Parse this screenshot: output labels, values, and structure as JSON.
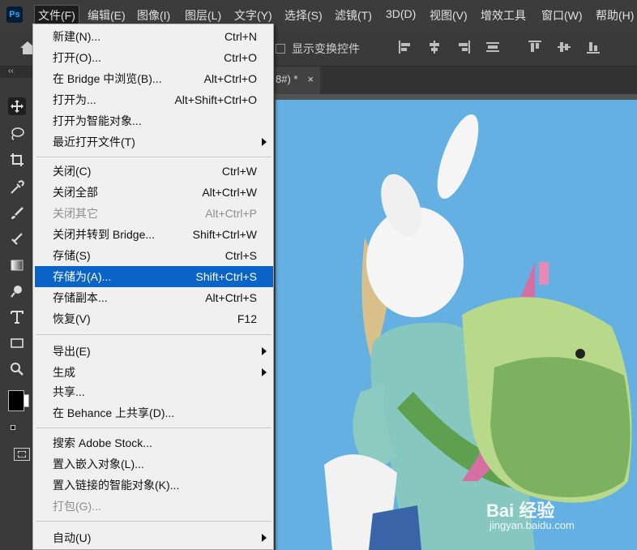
{
  "app": {
    "logo_text": "Ps"
  },
  "menubar": {
    "items": [
      "文件(F)",
      "编辑(E)",
      "图像(I)",
      "图层(L)",
      "文字(Y)",
      "选择(S)",
      "滤镜(T)",
      "3D(D)",
      "视图(V)",
      "增效工具",
      "窗口(W)",
      "帮助(H)"
    ]
  },
  "options": {
    "show_transform_label": "显示变换控件"
  },
  "collapse_label": "‹‹",
  "document_tab": {
    "title": "8#) *",
    "close": "×"
  },
  "file_menu": {
    "items": [
      {
        "label": "新建(N)...",
        "shortcut": "Ctrl+N"
      },
      {
        "label": "打开(O)...",
        "shortcut": "Ctrl+O"
      },
      {
        "label": "在 Bridge 中浏览(B)...",
        "shortcut": "Alt+Ctrl+O"
      },
      {
        "label": "打开为...",
        "shortcut": "Alt+Shift+Ctrl+O"
      },
      {
        "label": "打开为智能对象...",
        "shortcut": ""
      },
      {
        "label": "最近打开文件(T)",
        "shortcut": ""
      },
      {
        "label": "关闭(C)",
        "shortcut": "Ctrl+W"
      },
      {
        "label": "关闭全部",
        "shortcut": "Alt+Ctrl+W"
      },
      {
        "label": "关闭其它",
        "shortcut": "Alt+Ctrl+P"
      },
      {
        "label": "关闭并转到 Bridge...",
        "shortcut": "Shift+Ctrl+W"
      },
      {
        "label": "存储(S)",
        "shortcut": "Ctrl+S"
      },
      {
        "label": "存储为(A)...",
        "shortcut": "Shift+Ctrl+S"
      },
      {
        "label": "存储副本...",
        "shortcut": "Alt+Ctrl+S"
      },
      {
        "label": "恢复(V)",
        "shortcut": "F12"
      },
      {
        "label": "导出(E)",
        "shortcut": ""
      },
      {
        "label": "生成",
        "shortcut": ""
      },
      {
        "label": "共享...",
        "shortcut": ""
      },
      {
        "label": "在 Behance 上共享(D)...",
        "shortcut": ""
      },
      {
        "label": "搜索 Adobe Stock...",
        "shortcut": ""
      },
      {
        "label": "置入嵌入对象(L)...",
        "shortcut": ""
      },
      {
        "label": "置入链接的智能对象(K)...",
        "shortcut": ""
      },
      {
        "label": "打包(G)...",
        "shortcut": ""
      },
      {
        "label": "自动(U)",
        "shortcut": ""
      }
    ]
  },
  "watermark": {
    "brand": "Bai 经验",
    "url": "jingyan.baidu.com"
  },
  "colors": {
    "accent": "#0a64c8",
    "canvas_sky": "#64b0e2"
  }
}
